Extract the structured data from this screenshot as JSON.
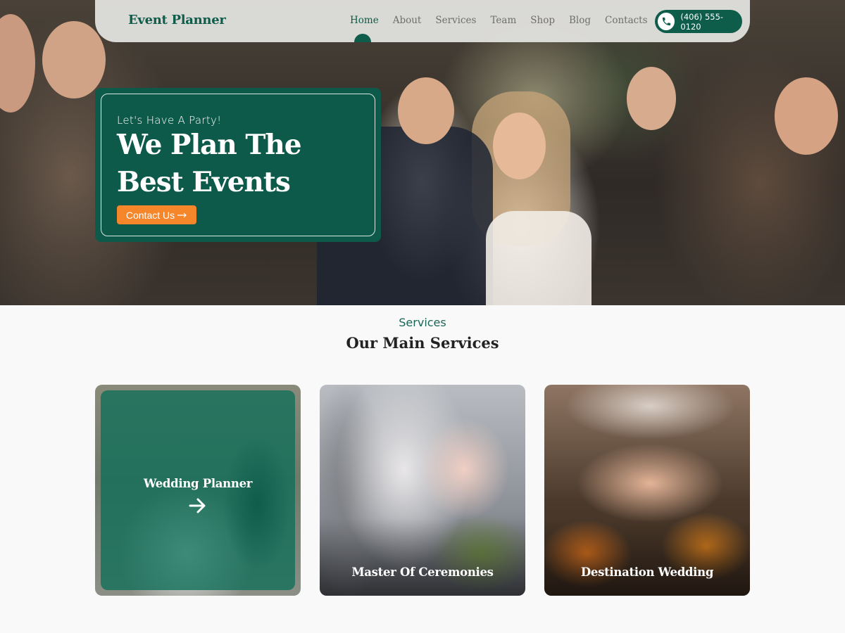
{
  "navbar": {
    "brand": "Event Planner",
    "items": [
      {
        "label": "Home",
        "active": true
      },
      {
        "label": "About",
        "active": false
      },
      {
        "label": "Services",
        "active": false
      },
      {
        "label": "Team",
        "active": false
      },
      {
        "label": "Shop",
        "active": false
      },
      {
        "label": "Blog",
        "active": false
      },
      {
        "label": "Contacts",
        "active": false
      }
    ],
    "phone": "(406) 555-0120",
    "phone_icon": "phone-icon"
  },
  "hero": {
    "tagline": "Let's Have A Party!",
    "headline": "We Plan The Best Events",
    "cta_label": "Contact Us",
    "cta_icon": "arrow-right-icon"
  },
  "services": {
    "eyebrow": "Services",
    "title": "Our Main Services",
    "cards": [
      {
        "title": "Wedding Planner",
        "highlighted": true,
        "icon": "arrow-right-icon"
      },
      {
        "title": "Master Of Ceremonies",
        "highlighted": false
      },
      {
        "title": "Destination Wedding",
        "highlighted": false
      }
    ]
  },
  "colors": {
    "brand_green": "#0e5c4a",
    "accent_orange": "#f5862a",
    "page_bg": "#f9f9f9"
  }
}
